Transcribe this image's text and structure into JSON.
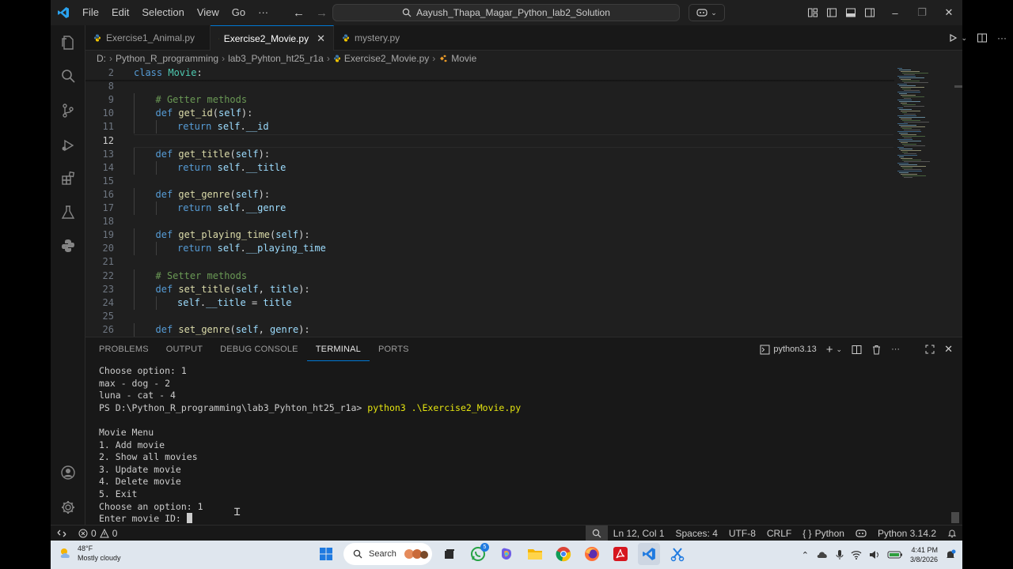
{
  "titlebar": {
    "menus": [
      "File",
      "Edit",
      "Selection",
      "View",
      "Go",
      "···"
    ],
    "search_text": "Aayush_Thapa_Magar_Python_lab2_Solution",
    "win_minimize": "–",
    "win_restore": "❐",
    "win_close": "✕"
  },
  "tabs": [
    {
      "label": "Exercise1_Animal.py",
      "active": false
    },
    {
      "label": "Exercise2_Movie.py",
      "active": true,
      "close": "✕"
    },
    {
      "label": "mystery.py",
      "active": false
    }
  ],
  "breadcrumb": [
    "D:",
    "Python_R_programming",
    "lab3_Pyhton_ht25_r1a",
    "Exercise2_Movie.py",
    "Movie"
  ],
  "editor": {
    "lines": [
      {
        "n": "2",
        "indent": 0,
        "tokens": [
          {
            "t": "kw",
            "v": "class"
          },
          {
            "t": "pl",
            "v": " "
          },
          {
            "t": "cls",
            "v": "Movie"
          },
          {
            "t": "pl",
            "v": ":"
          }
        ]
      },
      {
        "n": "8",
        "indent": 0,
        "tokens": []
      },
      {
        "n": "9",
        "indent": 1,
        "tokens": [
          {
            "t": "cm",
            "v": "# Getter methods"
          }
        ]
      },
      {
        "n": "10",
        "indent": 1,
        "tokens": [
          {
            "t": "kw",
            "v": "def"
          },
          {
            "t": "pl",
            "v": " "
          },
          {
            "t": "fn",
            "v": "get_id"
          },
          {
            "t": "pl",
            "v": "("
          },
          {
            "t": "sf",
            "v": "self"
          },
          {
            "t": "pl",
            "v": "):"
          }
        ]
      },
      {
        "n": "11",
        "indent": 2,
        "tokens": [
          {
            "t": "kw",
            "v": "return"
          },
          {
            "t": "pl",
            "v": " "
          },
          {
            "t": "sf",
            "v": "self"
          },
          {
            "t": "pl",
            "v": "."
          },
          {
            "t": "sf",
            "v": "__id"
          }
        ]
      },
      {
        "n": "12",
        "indent": 0,
        "tokens": [],
        "active": true
      },
      {
        "n": "13",
        "indent": 1,
        "tokens": [
          {
            "t": "kw",
            "v": "def"
          },
          {
            "t": "pl",
            "v": " "
          },
          {
            "t": "fn",
            "v": "get_title"
          },
          {
            "t": "pl",
            "v": "("
          },
          {
            "t": "sf",
            "v": "self"
          },
          {
            "t": "pl",
            "v": "):"
          }
        ]
      },
      {
        "n": "14",
        "indent": 2,
        "tokens": [
          {
            "t": "kw",
            "v": "return"
          },
          {
            "t": "pl",
            "v": " "
          },
          {
            "t": "sf",
            "v": "self"
          },
          {
            "t": "pl",
            "v": "."
          },
          {
            "t": "sf",
            "v": "__title"
          }
        ]
      },
      {
        "n": "15",
        "indent": 0,
        "tokens": []
      },
      {
        "n": "16",
        "indent": 1,
        "tokens": [
          {
            "t": "kw",
            "v": "def"
          },
          {
            "t": "pl",
            "v": " "
          },
          {
            "t": "fn",
            "v": "get_genre"
          },
          {
            "t": "pl",
            "v": "("
          },
          {
            "t": "sf",
            "v": "self"
          },
          {
            "t": "pl",
            "v": "):"
          }
        ]
      },
      {
        "n": "17",
        "indent": 2,
        "tokens": [
          {
            "t": "kw",
            "v": "return"
          },
          {
            "t": "pl",
            "v": " "
          },
          {
            "t": "sf",
            "v": "self"
          },
          {
            "t": "pl",
            "v": "."
          },
          {
            "t": "sf",
            "v": "__genre"
          }
        ]
      },
      {
        "n": "18",
        "indent": 0,
        "tokens": []
      },
      {
        "n": "19",
        "indent": 1,
        "tokens": [
          {
            "t": "kw",
            "v": "def"
          },
          {
            "t": "pl",
            "v": " "
          },
          {
            "t": "fn",
            "v": "get_playing_time"
          },
          {
            "t": "pl",
            "v": "("
          },
          {
            "t": "sf",
            "v": "self"
          },
          {
            "t": "pl",
            "v": "):"
          }
        ]
      },
      {
        "n": "20",
        "indent": 2,
        "tokens": [
          {
            "t": "kw",
            "v": "return"
          },
          {
            "t": "pl",
            "v": " "
          },
          {
            "t": "sf",
            "v": "self"
          },
          {
            "t": "pl",
            "v": "."
          },
          {
            "t": "sf",
            "v": "__playing_time"
          }
        ]
      },
      {
        "n": "21",
        "indent": 0,
        "tokens": []
      },
      {
        "n": "22",
        "indent": 1,
        "tokens": [
          {
            "t": "cm",
            "v": "# Setter methods"
          }
        ]
      },
      {
        "n": "23",
        "indent": 1,
        "tokens": [
          {
            "t": "kw",
            "v": "def"
          },
          {
            "t": "pl",
            "v": " "
          },
          {
            "t": "fn",
            "v": "set_title"
          },
          {
            "t": "pl",
            "v": "("
          },
          {
            "t": "sf",
            "v": "self"
          },
          {
            "t": "pl",
            "v": ", "
          },
          {
            "t": "sf",
            "v": "title"
          },
          {
            "t": "pl",
            "v": "):"
          }
        ]
      },
      {
        "n": "24",
        "indent": 2,
        "tokens": [
          {
            "t": "sf",
            "v": "self"
          },
          {
            "t": "pl",
            "v": "."
          },
          {
            "t": "sf",
            "v": "__title"
          },
          {
            "t": "pl",
            "v": " = "
          },
          {
            "t": "sf",
            "v": "title"
          }
        ]
      },
      {
        "n": "25",
        "indent": 0,
        "tokens": []
      },
      {
        "n": "26",
        "indent": 1,
        "tokens": [
          {
            "t": "kw",
            "v": "def"
          },
          {
            "t": "pl",
            "v": " "
          },
          {
            "t": "fn",
            "v": "set_genre"
          },
          {
            "t": "pl",
            "v": "("
          },
          {
            "t": "sf",
            "v": "self"
          },
          {
            "t": "pl",
            "v": ", "
          },
          {
            "t": "sf",
            "v": "genre"
          },
          {
            "t": "pl",
            "v": "):"
          }
        ]
      }
    ]
  },
  "panel": {
    "tabs": [
      "PROBLEMS",
      "OUTPUT",
      "DEBUG CONSOLE",
      "TERMINAL",
      "PORTS"
    ],
    "active_tab": "TERMINAL",
    "terminal_name": "python3.13"
  },
  "terminal": {
    "lines_before": [
      "Choose option: 1",
      "max - dog - 2",
      "luna - cat - 4"
    ],
    "prompt": "PS D:\\Python_R_programming\\lab3_Pyhton_ht25_r1a> ",
    "command": "python3 .\\Exercise2_Movie.py",
    "lines_after": [
      "",
      "Movie Menu",
      "1. Add movie",
      "2. Show all movies",
      "3. Update movie",
      "4. Delete movie",
      "5. Exit",
      "Choose an option: 1"
    ],
    "input_prompt": "Enter movie ID: "
  },
  "statusbar": {
    "errors": "0",
    "warnings": "0",
    "position": "Ln 12, Col 1",
    "spaces": "Spaces: 4",
    "encoding": "UTF-8",
    "eol": "CRLF",
    "language": "Python",
    "interpreter": "Python 3.14.2"
  },
  "taskbar": {
    "temp": "48°F",
    "weather": "Mostly cloudy",
    "search": "Search",
    "whatsapp_badge": "5",
    "time": "4:41 PM",
    "date": "3/8/2026"
  },
  "colors": {
    "accent": "#0078d4",
    "editor_bg": "#1f1f1f",
    "panel_bg": "#181818"
  }
}
